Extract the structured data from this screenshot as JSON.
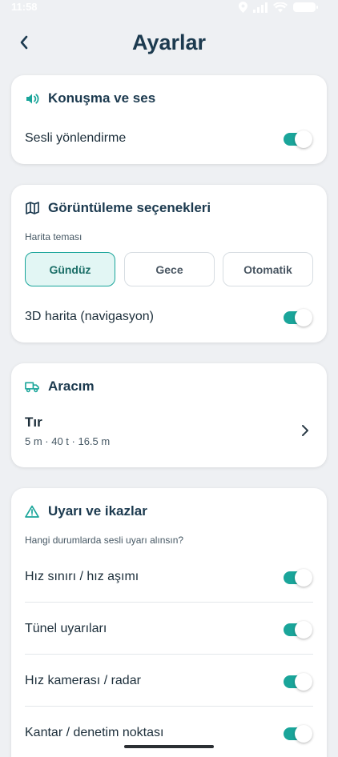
{
  "status_bar": {
    "time": "11:58"
  },
  "header": {
    "title": "Ayarlar"
  },
  "sections": {
    "speech": {
      "title": "Konuşma ve ses",
      "voice_guidance": {
        "label": "Sesli yönlendirme",
        "enabled": true
      }
    },
    "display": {
      "title": "Görüntüleme seçenekleri",
      "theme_label": "Harita teması",
      "theme_options": [
        "Gündüz",
        "Gece",
        "Otomatik"
      ],
      "selected_theme": "Gündüz",
      "map3d": {
        "label": "3D harita (navigasyon)",
        "enabled": true
      }
    },
    "vehicle": {
      "title": "Aracım",
      "name": "Tır",
      "spec": "5 m · 40 t · 16.5 m"
    },
    "alerts": {
      "title": "Uyarı ve ikazlar",
      "subtitle": "Hangi durumlarda sesli uyarı alınsın?",
      "items": [
        {
          "label": "Hız sınırı / hız aşımı",
          "enabled": true
        },
        {
          "label": "Tünel uyarıları",
          "enabled": true
        },
        {
          "label": "Hız kamerası / radar",
          "enabled": true
        },
        {
          "label": "Kantar / denetim noktası",
          "enabled": true
        }
      ]
    }
  },
  "colors": {
    "accent": "#1aa59a",
    "accent_light": "#e2f6f4",
    "title_text": "#1c3a4f",
    "background": "#eef0f3"
  }
}
